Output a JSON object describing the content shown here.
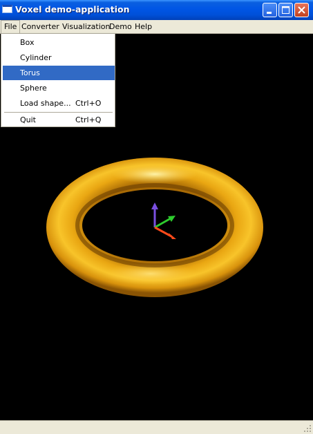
{
  "window": {
    "title": "Voxel demo-application",
    "buttons": [
      "minimize",
      "maximize",
      "close"
    ]
  },
  "menubar": {
    "items": [
      {
        "label": "File",
        "active": true
      },
      {
        "label": "Converter"
      },
      {
        "label": "Visualization"
      },
      {
        "label": "Demo"
      },
      {
        "label": "Help"
      }
    ]
  },
  "file_menu": {
    "items": [
      {
        "label": "Box",
        "shortcut": ""
      },
      {
        "label": "Cylinder",
        "shortcut": ""
      },
      {
        "label": "Torus",
        "shortcut": "",
        "highlighted": true
      },
      {
        "label": "Sphere",
        "shortcut": ""
      },
      {
        "label": "Load shape...",
        "shortcut": "Ctrl+O"
      },
      {
        "label": "Quit",
        "shortcut": "Ctrl+Q"
      }
    ]
  },
  "viewport": {
    "background": "#000000",
    "shape": "torus",
    "shape_color": "#f5b816",
    "axis_colors": {
      "x": "#ff4a1a",
      "y": "#2ecc2e",
      "z": "#7a4fe0"
    }
  }
}
